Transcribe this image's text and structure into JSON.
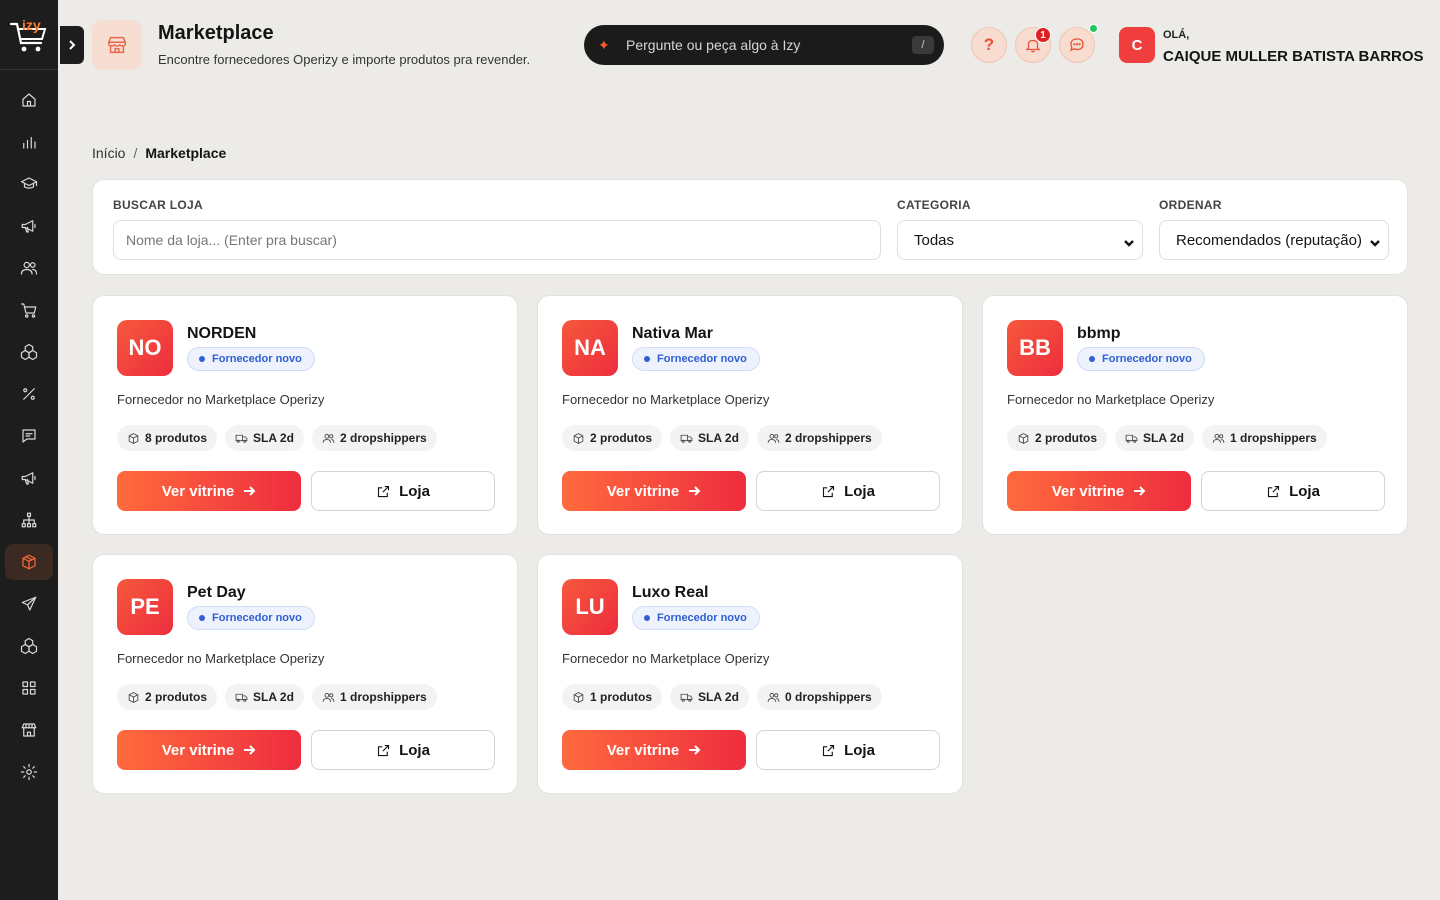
{
  "app": {
    "logo_text": "izy"
  },
  "sidebar": {
    "items": [
      {
        "icon": "home-icon"
      },
      {
        "icon": "bar-chart-icon"
      },
      {
        "icon": "graduation-cap-icon"
      },
      {
        "icon": "megaphone-icon"
      },
      {
        "icon": "users-icon"
      },
      {
        "icon": "cart-icon"
      },
      {
        "icon": "boxes-icon"
      },
      {
        "icon": "percent-icon"
      },
      {
        "icon": "message-square-icon"
      },
      {
        "icon": "megaphone-icon"
      },
      {
        "icon": "network-icon"
      },
      {
        "icon": "package-icon",
        "active": true
      },
      {
        "icon": "send-icon"
      },
      {
        "icon": "boxes-icon"
      },
      {
        "icon": "grid-icon"
      },
      {
        "icon": "store-icon"
      },
      {
        "icon": "settings-icon"
      }
    ]
  },
  "header": {
    "title": "Marketplace",
    "subtitle": "Encontre fornecedores Operizy e importe produtos pra revender.",
    "ask_placeholder": "Pergunte ou peça algo à Izy",
    "ask_shortcut": "/",
    "help_label": "?",
    "notification_count": "1",
    "avatar_initial": "C",
    "greeting": "OLÁ,",
    "user_name": "CAIQUE MULLER BATISTA BARROS"
  },
  "breadcrumb": {
    "home": "Início",
    "separator": "/",
    "current": "Marketplace"
  },
  "filters": {
    "search_label": "BUSCAR LOJA",
    "search_placeholder": "Nome da loja... (Enter pra buscar)",
    "category_label": "CATEGORIA",
    "category_value": "Todas",
    "order_label": "ORDENAR",
    "order_value": "Recomendados (reputação)"
  },
  "stores": [
    {
      "initials": "NO",
      "name": "NORDEN",
      "badge": "Fornecedor novo",
      "description": "Fornecedor no Marketplace Operizy",
      "products": "8 produtos",
      "sla": "SLA 2d",
      "dropshippers": "2 dropshippers",
      "primary_label": "Ver vitrine",
      "secondary_label": "Loja"
    },
    {
      "initials": "NA",
      "name": "Nativa Mar",
      "badge": "Fornecedor novo",
      "description": "Fornecedor no Marketplace Operizy",
      "products": "2 produtos",
      "sla": "SLA 2d",
      "dropshippers": "2 dropshippers",
      "primary_label": "Ver vitrine",
      "secondary_label": "Loja"
    },
    {
      "initials": "BB",
      "name": "bbmp",
      "badge": "Fornecedor novo",
      "description": "Fornecedor no Marketplace Operizy",
      "products": "2 produtos",
      "sla": "SLA 2d",
      "dropshippers": "1 dropshippers",
      "primary_label": "Ver vitrine",
      "secondary_label": "Loja"
    },
    {
      "initials": "PE",
      "name": "Pet Day",
      "badge": "Fornecedor novo",
      "description": "Fornecedor no Marketplace Operizy",
      "products": "2 produtos",
      "sla": "SLA 2d",
      "dropshippers": "1 dropshippers",
      "primary_label": "Ver vitrine",
      "secondary_label": "Loja"
    },
    {
      "initials": "LU",
      "name": "Luxo Real",
      "badge": "Fornecedor novo",
      "description": "Fornecedor no Marketplace Operizy",
      "products": "1 produtos",
      "sla": "SLA 2d",
      "dropshippers": "0 dropshippers",
      "primary_label": "Ver vitrine",
      "secondary_label": "Loja"
    }
  ],
  "colors": {
    "accent": "#ff6a3d",
    "accent_end": "#ee2d3e",
    "sidebar_bg": "#1d1d1d",
    "page_bg": "#ecebe8",
    "badge_blue": "#2f5fd0",
    "online": "#22c55e"
  }
}
